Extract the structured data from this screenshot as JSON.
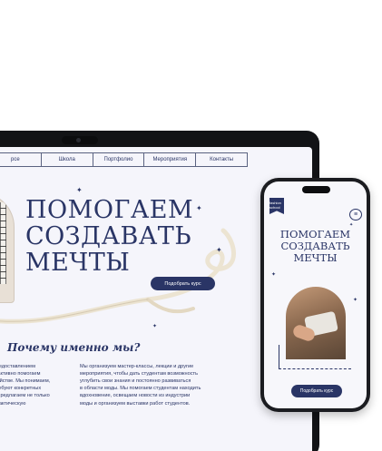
{
  "laptop": {
    "nav": [
      "рсе",
      "Школа",
      "Портфолио",
      "Мероприятия",
      "Контакты"
    ],
    "hero_lines": [
      "ПОМОГАЕМ",
      "СОЗДАВАТЬ",
      "МЕЧТЫ"
    ],
    "cta_label": "Подобрать курс",
    "why_title": "Почему именно мы?",
    "col_left": "о предоставлением\nо и активно помогаем\nстройстве. Мы понимаем,\nи требуют конкретных\nмы предлагаем не только\nи практическую",
    "col_right": "Мы организуем мастер-классы, лекции и другие\nмероприятия, чтобы дать студентам возможность\nуглубить свои знания и постоянно развиваться\nв области моды. Мы помогаем студентам находить\nвдохновение, освещаем новости из индустрии\nмоды и организуем выставки работ студентов."
  },
  "phone": {
    "logo_text": "fashion school",
    "menu_icon": "≡",
    "hero_lines": [
      "ПОМОГАЕМ",
      "СОЗДАВАТЬ",
      "МЕЧТЫ"
    ],
    "cta_label": "Подобрать курс"
  },
  "colors": {
    "accent": "#2a3566",
    "background": "#f5f5fb",
    "device": "#121316"
  }
}
